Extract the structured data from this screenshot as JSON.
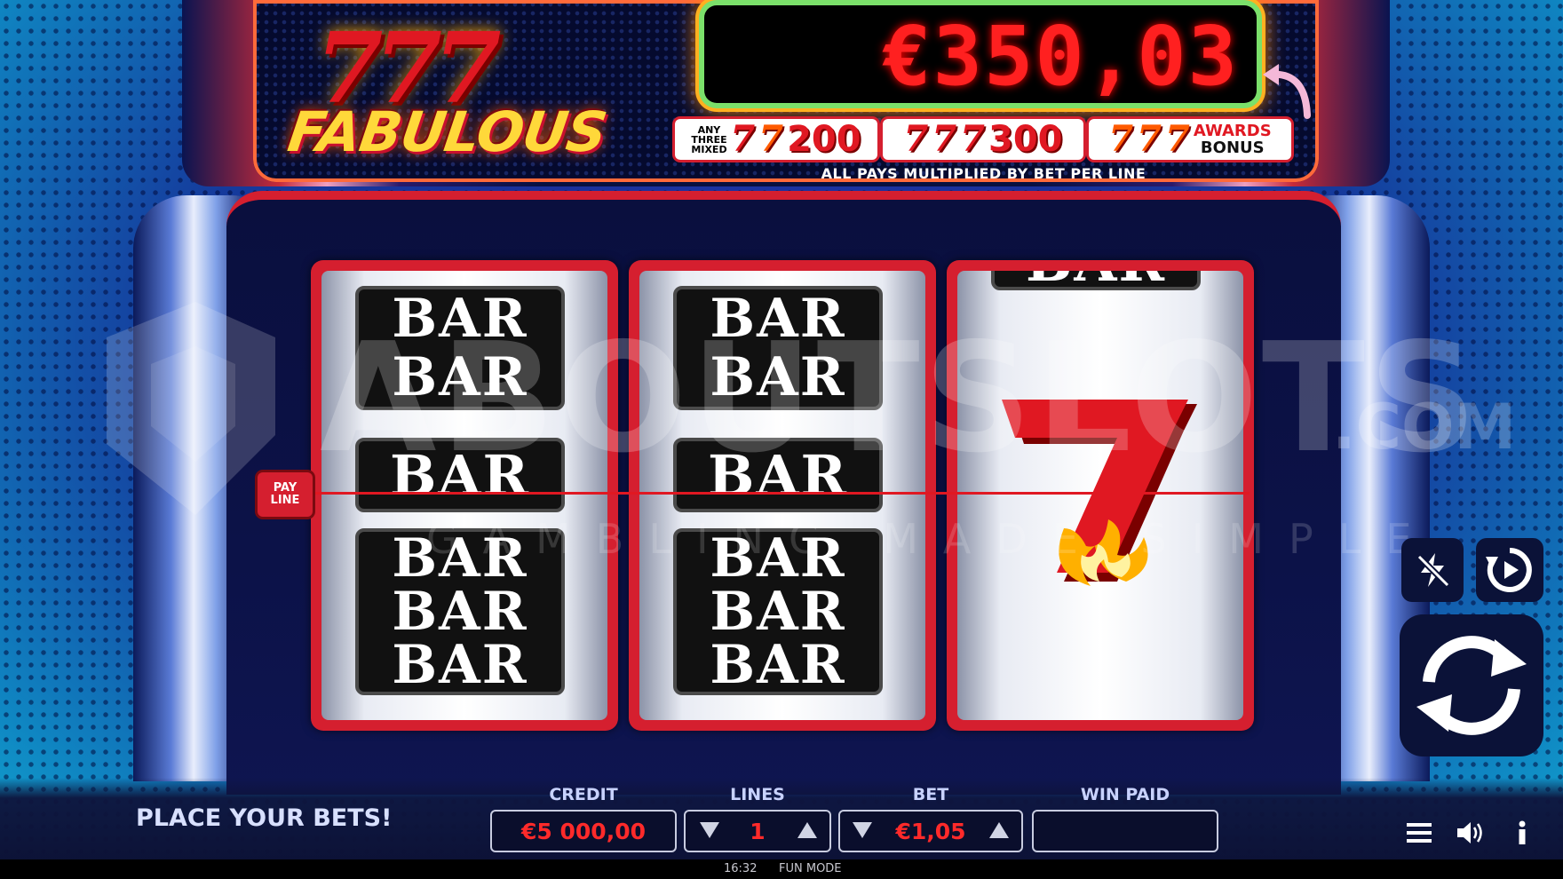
{
  "game": {
    "logo_sevens": "777",
    "logo_word": "FABULOUS"
  },
  "jackpot": {
    "value": "€350,03"
  },
  "paytable": {
    "mixed_label_1": "ANY",
    "mixed_label_2": "THREE",
    "mixed_label_3": "MIXED",
    "mixed_value": "200",
    "three_seven_value": "300",
    "awards_1": "AWARDS",
    "awards_2": "BONUS",
    "seven_glyph": "7",
    "footer": "ALL PAYS MULTIPLIED BY BET PER LINE"
  },
  "reels": {
    "symbol_bar": "BAR",
    "payline_1": "PAY",
    "payline_2": "LINE"
  },
  "watermark": {
    "main": "ABOUTSLOTS",
    "com": ".COM",
    "sub": "GAMBLING MADE SIMPLE"
  },
  "status": {
    "message": "PLACE YOUR BETS!"
  },
  "meters": {
    "credit_label": "CREDIT",
    "credit_value": "€5 000,00",
    "lines_label": "LINES",
    "lines_value": "1",
    "bet_label": "BET",
    "bet_value": "€1,05",
    "win_label": "WIN PAID",
    "win_value": ""
  },
  "footer": {
    "time": "16:32",
    "mode": "FUN MODE"
  },
  "colors": {
    "accent_red": "#e01822",
    "jackpot_glow": "#ff8a00",
    "panel_dark": "#0b1238"
  },
  "icons": [
    "turbo-off-icon",
    "autoplay-icon",
    "spin-icon",
    "menu-icon",
    "sound-icon",
    "info-icon",
    "arrow-icon"
  ]
}
